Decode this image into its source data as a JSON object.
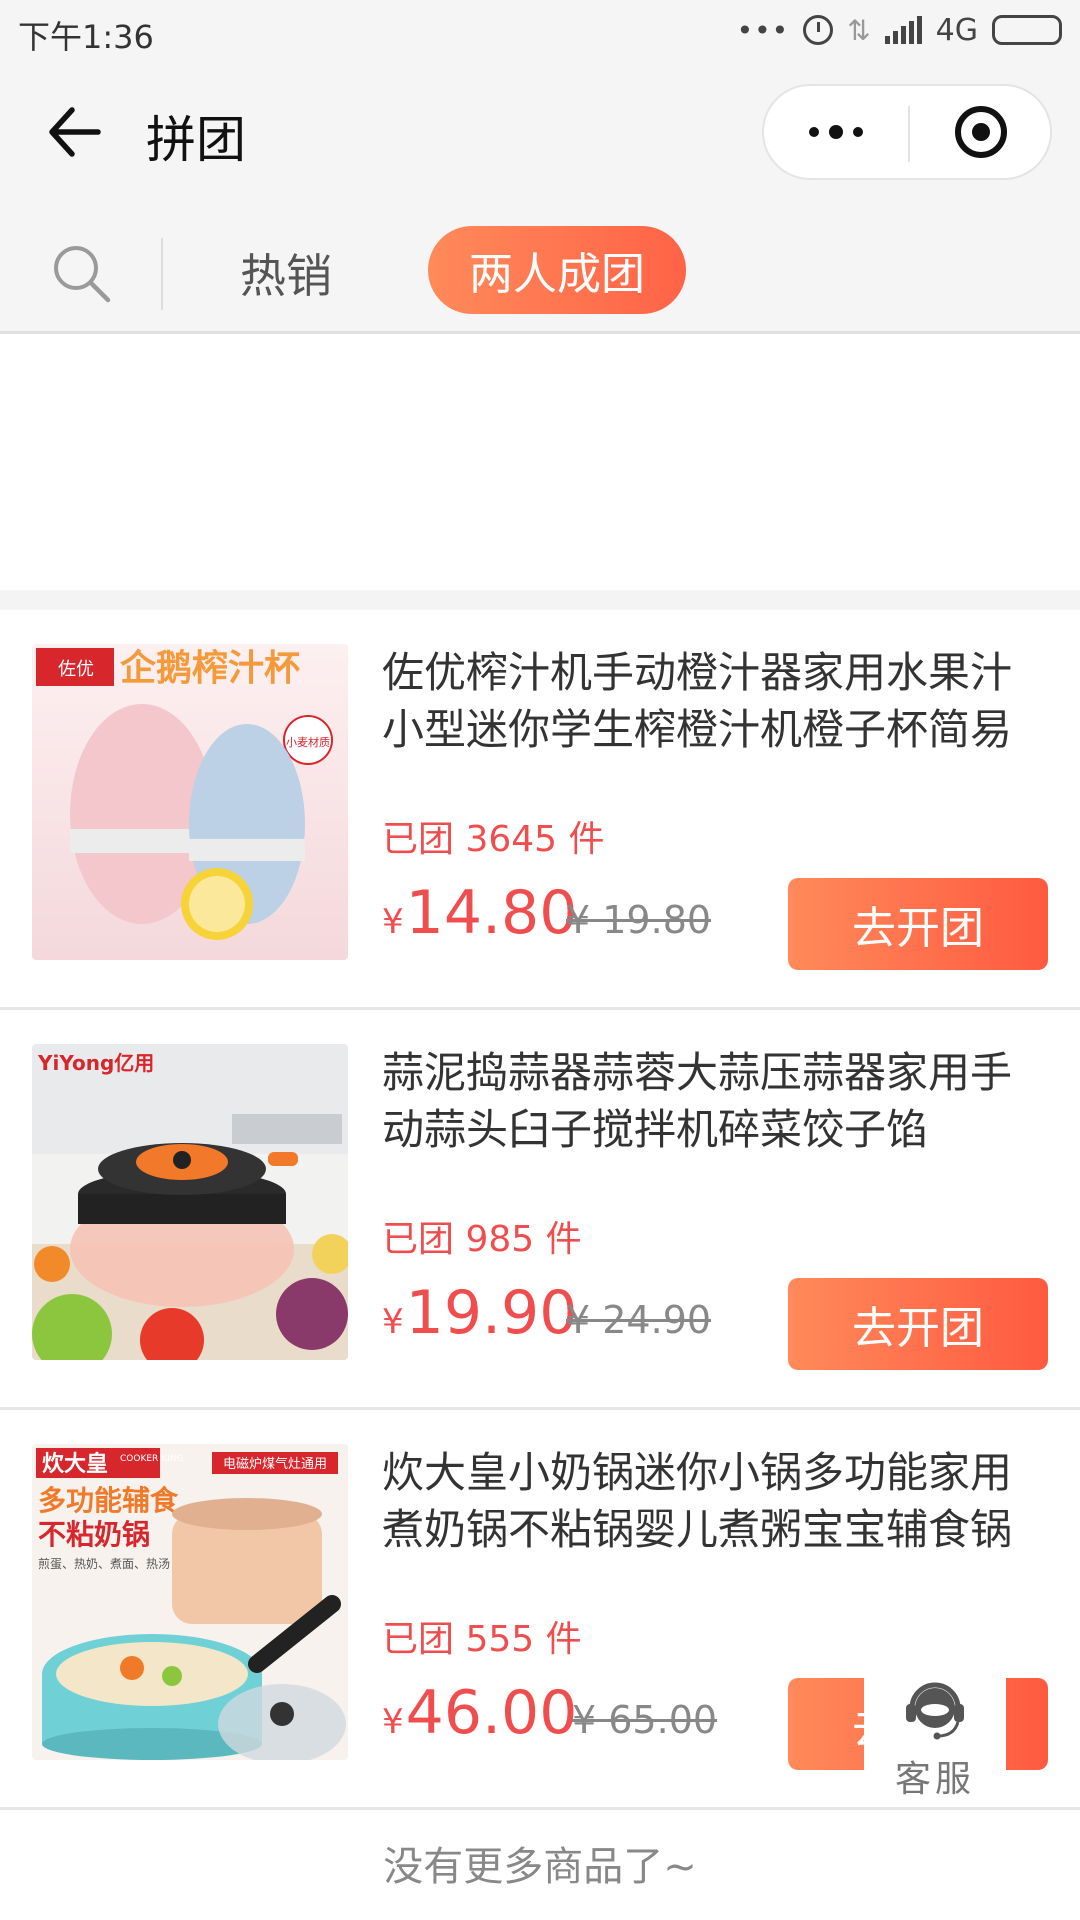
{
  "status_bar": {
    "time": "下午1:36",
    "network": "4G"
  },
  "nav": {
    "title": "拼团"
  },
  "tabs": {
    "hot": "热销",
    "two_person": "两人成团"
  },
  "products": [
    {
      "title": "佐优榨汁机手动橙汁器家用水果汁小型迷你学生榨橙汁机橙子杯简易",
      "sold": "已团 3645 件",
      "yen": "¥",
      "price": "14.80",
      "original_price": "¥ 19.80",
      "button": "去开团",
      "image_caption": "企鹅榨汁杯",
      "image_brand": "佐优",
      "image_badge": "小麦材质"
    },
    {
      "title": "蒜泥捣蒜器蒜蓉大蒜压蒜器家用手动蒜头臼子搅拌机碎菜饺子馅",
      "sold": "已团 985 件",
      "yen": "¥",
      "price": "19.90",
      "original_price": "¥ 24.90",
      "button": "去开团",
      "image_brand": "YiYong亿用"
    },
    {
      "title": "炊大皇小奶锅迷你小锅多功能家用煮奶锅不粘锅婴儿煮粥宝宝辅食锅",
      "sold": "已团 555 件",
      "yen": "¥",
      "price": "46.00",
      "original_price": "¥ 65.00",
      "button": "去开团",
      "image_brand": "炊大皇",
      "image_brand_en": "COOKER KING",
      "image_tag": "电磁炉煤气灶通用",
      "image_line1": "多功能辅食",
      "image_line2": "不粘奶锅",
      "image_small": "煎蛋、热奶、煮面、热汤"
    }
  ],
  "service": {
    "label": "客服"
  },
  "footer": {
    "end_text": "没有更多商品了~"
  },
  "colors": {
    "accent": "#ff6347",
    "price": "#f04e4e"
  }
}
